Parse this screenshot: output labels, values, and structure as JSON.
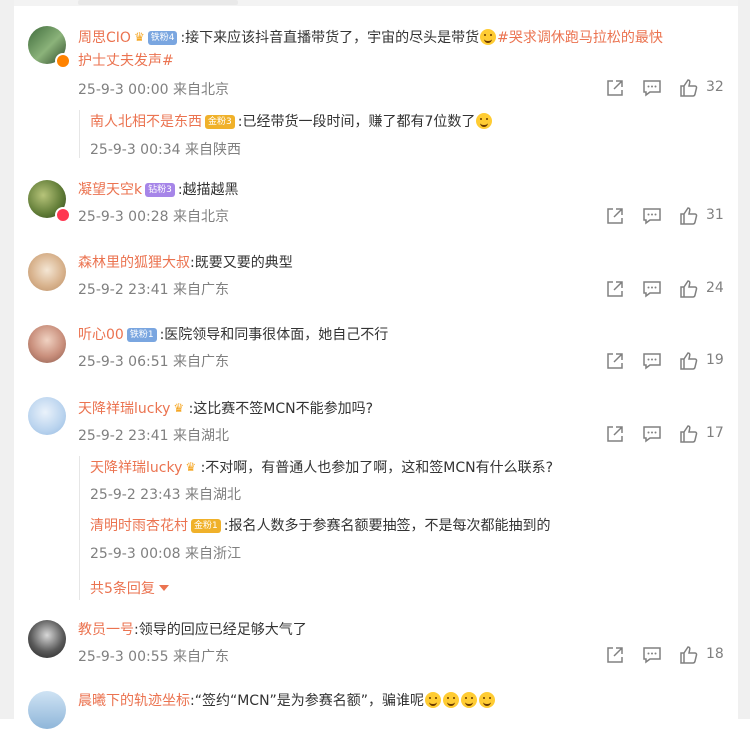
{
  "comments": [
    {
      "user": "周思CIO",
      "badge": "铁粉4",
      "text_line1": ":接下来应该抖音直播带货了，宇宙的尽头是带货",
      "hashtag_line1": "#哭求调休跑马拉松的最快",
      "hashtag_line2": "护士丈夫发声#",
      "meta": "25-9-3 00:00 来自北京",
      "likes": "32",
      "reply": {
        "user": "南人北相不是东西",
        "badge": "金粉3",
        "text": ":已经带货一段时间，赚了都有7位数了",
        "meta": "25-9-3 00:34 来自陕西"
      }
    },
    {
      "user": "凝望天空k",
      "badge": "钻粉3",
      "text": ":越描越黑",
      "meta": "25-9-3 00:28 来自北京",
      "likes": "31"
    },
    {
      "user": "森林里的狐狸大叔",
      "text": ":既要又要的典型",
      "meta": "25-9-2 23:41 来自广东",
      "likes": "24"
    },
    {
      "user": "听心00",
      "badge": "铁粉1",
      "text": ":医院领导和同事很体面，她自己不行",
      "meta": "25-9-3 06:51 来自广东",
      "likes": "19"
    },
    {
      "user": "天降祥瑞lucky",
      "text": ":这比赛不签MCN不能参加吗?",
      "meta": "25-9-2 23:41 来自湖北",
      "likes": "17",
      "replies": [
        {
          "user": "天降祥瑞lucky",
          "text": ":不对啊，有普通人也参加了啊，这和签MCN有什么联系?",
          "meta": "25-9-2 23:43 来自湖北"
        },
        {
          "user": "清明时雨杏花村",
          "badge": "金粉1",
          "text": ":报名人数多于参赛名额要抽签，不是每次都能抽到的",
          "meta": "25-9-3 00:08 来自浙江"
        }
      ],
      "expand_label": "共5条回复"
    },
    {
      "user": "教员一号",
      "text": ":领导的回应已经足够大气了",
      "meta": "25-9-3 00:55 来自广东",
      "likes": "18"
    },
    {
      "user": "晨曦下的轨迹坐标",
      "text": ":“签约“MCN”是为参赛名额”，骗谁呢"
    }
  ],
  "colors": {
    "accent": "#eb7350",
    "meta": "#808080",
    "badge_fan": "#7aa6e0",
    "badge_gold": "#f0b12a",
    "badge_diamond": "#a685e8"
  },
  "icons": [
    "share-icon",
    "comment-icon",
    "like-icon"
  ]
}
